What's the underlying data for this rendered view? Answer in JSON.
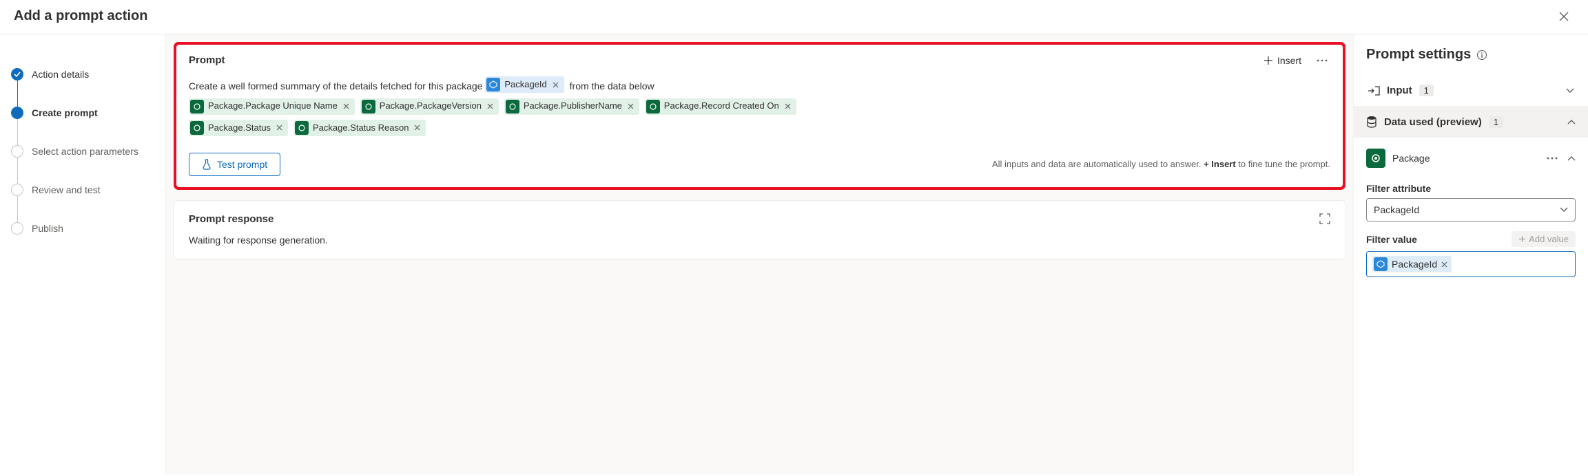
{
  "header": {
    "title": "Add a prompt action"
  },
  "steps": [
    {
      "label": "Action details",
      "state": "done"
    },
    {
      "label": "Create prompt",
      "state": "current"
    },
    {
      "label": "Select action parameters",
      "state": "pending"
    },
    {
      "label": "Review and test",
      "state": "pending"
    },
    {
      "label": "Publish",
      "state": "pending"
    }
  ],
  "prompt": {
    "title": "Prompt",
    "insert_label": "Insert",
    "text_before": "Create a well formed summary of the details fetched for this package",
    "text_after": "from the data below",
    "input_token": "PackageId",
    "data_tokens": [
      "Package.Package Unique Name",
      "Package.PackageVersion",
      "Package.PublisherName",
      "Package.Record Created On",
      "Package.Status",
      "Package.Status Reason"
    ],
    "test_label": "Test prompt",
    "hint_before": "All inputs and data are automatically used to answer. ",
    "hint_bold": "+ Insert",
    "hint_after": " to fine tune the prompt."
  },
  "response": {
    "title": "Prompt response",
    "waiting": "Waiting for response generation."
  },
  "settings": {
    "title": "Prompt settings",
    "input_label": "Input",
    "input_count": "1",
    "data_label": "Data used (preview)",
    "data_count": "1",
    "entity_name": "Package",
    "filter_attr_label": "Filter attribute",
    "filter_attr_value": "PackageId",
    "filter_value_label": "Filter value",
    "add_value_label": "Add value",
    "filter_value_token": "PackageId"
  }
}
